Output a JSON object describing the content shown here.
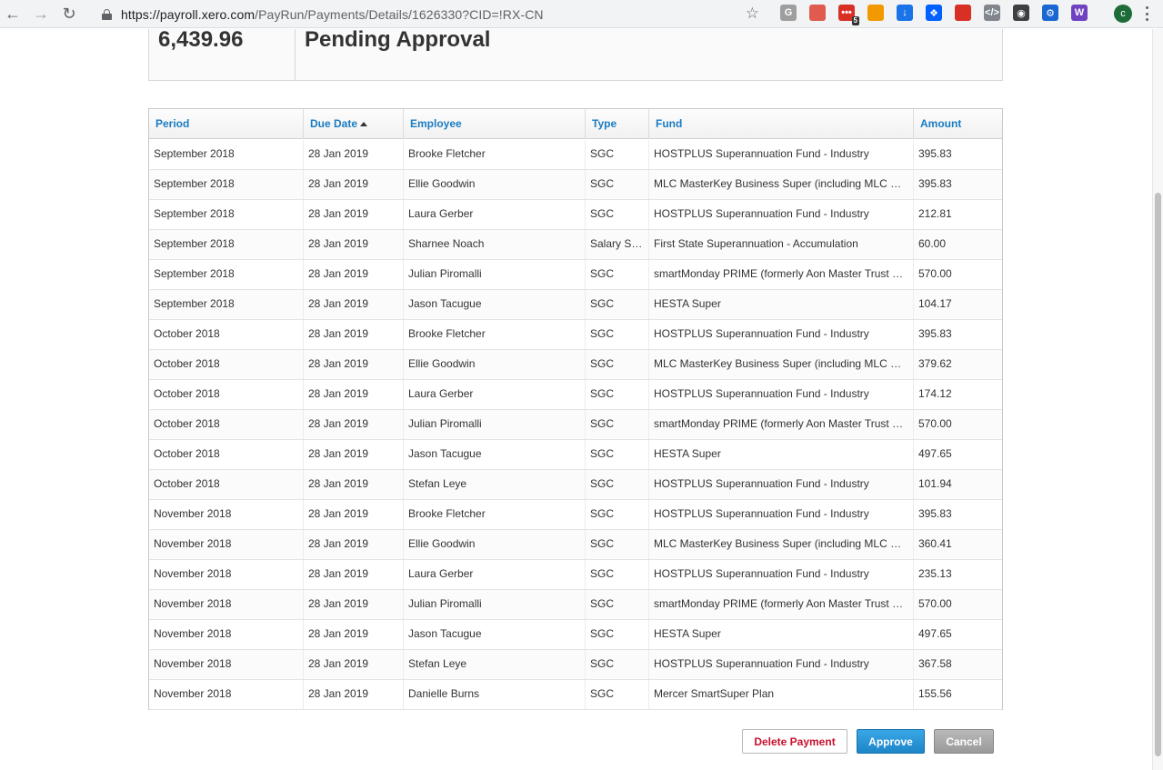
{
  "browser": {
    "url_host": "https://payroll.xero.com",
    "url_path": "/PayRun/Payments/Details/1626330?CID=!RX-CN",
    "ext_badge": "5",
    "avatar_initial": "c",
    "extensions": [
      {
        "name": "g-extension-icon",
        "label": "G",
        "color": "#9e9e9e"
      },
      {
        "name": "arrow-extension-icon",
        "label": "",
        "color": "#e05a4f"
      },
      {
        "name": "dots-extension-icon",
        "label": "•••",
        "color": "#d93025"
      },
      {
        "name": "rainbow-extension-icon",
        "label": "",
        "color": "#f29900"
      },
      {
        "name": "download-extension-icon",
        "label": "↓",
        "color": "#1a73e8"
      },
      {
        "name": "dropbox-extension-icon",
        "label": "❖",
        "color": "#0061ff"
      },
      {
        "name": "red-box-extension-icon",
        "label": "",
        "color": "#d93025"
      },
      {
        "name": "code-extension-icon",
        "label": "</>",
        "color": "#80868b"
      },
      {
        "name": "bulb-extension-icon",
        "label": "◉",
        "color": "#3c4043"
      },
      {
        "name": "gear-extension-icon",
        "label": "⚙",
        "color": "#1967d2"
      },
      {
        "name": "w-extension-icon",
        "label": "W",
        "color": "#6f42c1"
      }
    ]
  },
  "summary": {
    "total": "6,439.96",
    "status": "Pending Approval"
  },
  "columns": {
    "period": "Period",
    "due_date": "Due Date",
    "employee": "Employee",
    "type": "Type",
    "fund": "Fund",
    "amount": "Amount"
  },
  "rows": [
    {
      "period": "September 2018",
      "due": "28 Jan 2019",
      "employee": "Brooke Fletcher",
      "type": "SGC",
      "fund": "HOSTPLUS Superannuation Fund - Industry",
      "amount": "395.83"
    },
    {
      "period": "September 2018",
      "due": "28 Jan 2019",
      "employee": "Ellie Goodwin",
      "type": "SGC",
      "fund": "MLC MasterKey Business Super (including MLC …",
      "amount": "395.83"
    },
    {
      "period": "September 2018",
      "due": "28 Jan 2019",
      "employee": "Laura Gerber",
      "type": "SGC",
      "fund": "HOSTPLUS Superannuation Fund - Industry",
      "amount": "212.81"
    },
    {
      "period": "September 2018",
      "due": "28 Jan 2019",
      "employee": "Sharnee Noach",
      "type": "Salary S…",
      "fund": "First State Superannuation - Accumulation",
      "amount": "60.00"
    },
    {
      "period": "September 2018",
      "due": "28 Jan 2019",
      "employee": "Julian Piromalli",
      "type": "SGC",
      "fund": "smartMonday PRIME (formerly Aon Master Trust …",
      "amount": "570.00"
    },
    {
      "period": "September 2018",
      "due": "28 Jan 2019",
      "employee": "Jason Tacugue",
      "type": "SGC",
      "fund": "HESTA Super",
      "amount": "104.17"
    },
    {
      "period": "October 2018",
      "due": "28 Jan 2019",
      "employee": "Brooke Fletcher",
      "type": "SGC",
      "fund": "HOSTPLUS Superannuation Fund - Industry",
      "amount": "395.83"
    },
    {
      "period": "October 2018",
      "due": "28 Jan 2019",
      "employee": "Ellie Goodwin",
      "type": "SGC",
      "fund": "MLC MasterKey Business Super (including MLC …",
      "amount": "379.62"
    },
    {
      "period": "October 2018",
      "due": "28 Jan 2019",
      "employee": "Laura Gerber",
      "type": "SGC",
      "fund": "HOSTPLUS Superannuation Fund - Industry",
      "amount": "174.12"
    },
    {
      "period": "October 2018",
      "due": "28 Jan 2019",
      "employee": "Julian Piromalli",
      "type": "SGC",
      "fund": "smartMonday PRIME (formerly Aon Master Trust …",
      "amount": "570.00"
    },
    {
      "period": "October 2018",
      "due": "28 Jan 2019",
      "employee": "Jason Tacugue",
      "type": "SGC",
      "fund": "HESTA Super",
      "amount": "497.65"
    },
    {
      "period": "October 2018",
      "due": "28 Jan 2019",
      "employee": "Stefan Leye",
      "type": "SGC",
      "fund": "HOSTPLUS Superannuation Fund - Industry",
      "amount": "101.94"
    },
    {
      "period": "November 2018",
      "due": "28 Jan 2019",
      "employee": "Brooke Fletcher",
      "type": "SGC",
      "fund": "HOSTPLUS Superannuation Fund - Industry",
      "amount": "395.83"
    },
    {
      "period": "November 2018",
      "due": "28 Jan 2019",
      "employee": "Ellie Goodwin",
      "type": "SGC",
      "fund": "MLC MasterKey Business Super (including MLC …",
      "amount": "360.41"
    },
    {
      "period": "November 2018",
      "due": "28 Jan 2019",
      "employee": "Laura Gerber",
      "type": "SGC",
      "fund": "HOSTPLUS Superannuation Fund - Industry",
      "amount": "235.13"
    },
    {
      "period": "November 2018",
      "due": "28 Jan 2019",
      "employee": "Julian Piromalli",
      "type": "SGC",
      "fund": "smartMonday PRIME (formerly Aon Master Trust …",
      "amount": "570.00"
    },
    {
      "period": "November 2018",
      "due": "28 Jan 2019",
      "employee": "Jason Tacugue",
      "type": "SGC",
      "fund": "HESTA Super",
      "amount": "497.65"
    },
    {
      "period": "November 2018",
      "due": "28 Jan 2019",
      "employee": "Stefan Leye",
      "type": "SGC",
      "fund": "HOSTPLUS Superannuation Fund - Industry",
      "amount": "367.58"
    },
    {
      "period": "November 2018",
      "due": "28 Jan 2019",
      "employee": "Danielle Burns",
      "type": "SGC",
      "fund": "Mercer SmartSuper Plan",
      "amount": "155.56"
    }
  ],
  "actions": {
    "delete": "Delete Payment",
    "approve": "Approve",
    "cancel": "Cancel"
  },
  "colors": {
    "header_link": "#1a7cc2",
    "delete_text": "#c8102e",
    "approve_bg": "#1d86c8",
    "cancel_bg": "#9a9a9a"
  }
}
